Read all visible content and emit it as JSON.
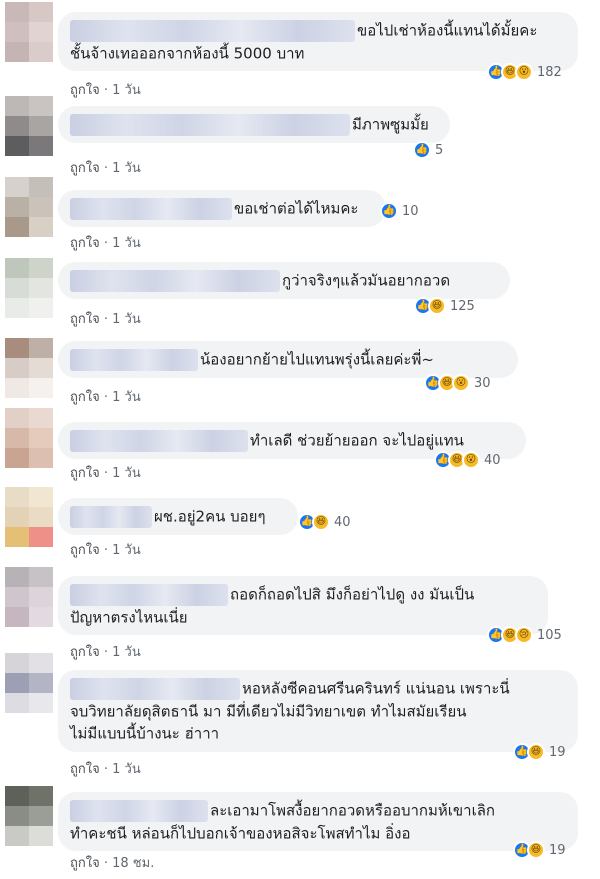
{
  "comments": [
    {
      "text_lines": [
        "ขอไปเช่าห้องนี้แทนได้มั้ยคะ",
        "ชั้นจ้างเทอออกจากห้องนี้ 5000 บาท"
      ],
      "like_label": "ถูกใจ",
      "time": "1 วัน",
      "reactions": [
        "like",
        "haha",
        "wow"
      ],
      "count": "182",
      "avatar_colors": [
        "#c8b9b8",
        "#d7c8c6",
        "#cfc0bf",
        "#e0d3d2",
        "#c4b4b4",
        "#dacccb"
      ]
    },
    {
      "text_lines": [
        "มีภาพซูมมั้ย"
      ],
      "like_label": "ถูกใจ",
      "time": "1 วัน",
      "reactions": [
        "like"
      ],
      "count": "5",
      "avatar_colors": [
        "#bdb8b6",
        "#c9c4c2",
        "#8f8b8a",
        "#a9a5a3",
        "#5d5c5e",
        "#7a787a"
      ]
    },
    {
      "text_lines": [
        "ขอเช่าต่อได้ไหมคะ"
      ],
      "like_label": "ถูกใจ",
      "time": "1 วัน",
      "reactions": [
        "like"
      ],
      "count": "10",
      "avatar_colors": [
        "#d6d1cd",
        "#c5bfb9",
        "#b9b0a6",
        "#cbc3b9",
        "#a8998b",
        "#d8cfc5"
      ]
    },
    {
      "text_lines": [
        "กูว่าจริงๆแล้วมันอยากอวด"
      ],
      "like_label": "ถูกใจ",
      "time": "1 วัน",
      "reactions": [
        "like",
        "haha"
      ],
      "count": "125",
      "avatar_colors": [
        "#bfc7bd",
        "#cfd4cb",
        "#d8dcd6",
        "#e3e5e1",
        "#e9ebe8",
        "#f0f1ef"
      ]
    },
    {
      "text_lines": [
        "น้องอยากย้ายไปแทนพรุ่งนี้เลยค่ะพี่~"
      ],
      "like_label": "ถูกใจ",
      "time": "1 วัน",
      "reactions": [
        "like",
        "haha",
        "wow"
      ],
      "count": "30",
      "avatar_colors": [
        "#a88d7e",
        "#bfb0a7",
        "#d8cdc6",
        "#e5dbd5",
        "#efe8e4",
        "#f5f1ee"
      ]
    },
    {
      "text_lines": [
        "ทำเลดี ช่วยย้ายออก จะไปอยู่แทน"
      ],
      "like_label": "ถูกใจ",
      "time": "1 วัน",
      "reactions": [
        "like",
        "haha",
        "wow"
      ],
      "count": "40",
      "avatar_colors": [
        "#e2cfc6",
        "#ead9d0",
        "#d6b9a9",
        "#e4cbbc",
        "#c9a492",
        "#dcbfb0"
      ]
    },
    {
      "text_lines": [
        "ผช.อยู่2คน บอยๆ"
      ],
      "like_label": "ถูกใจ",
      "time": "1 วัน",
      "reactions": [
        "like",
        "haha"
      ],
      "count": "40",
      "avatar_colors": [
        "#e8dcc6",
        "#f0e6d2",
        "#e4d2b6",
        "#eadcc4",
        "#e6bf76",
        "#ee8f88"
      ]
    },
    {
      "text_lines": [
        "ถอดก็ถอดไปสิ มึงก็อย่าไปดู งง มันเป็น",
        "ปัญหาตรงไหนเนี่ย"
      ],
      "like_label": "ถูกใจ",
      "time": "1 วัน",
      "reactions": [
        "like",
        "haha",
        "sad"
      ],
      "count": "105",
      "avatar_colors": [
        "#b7b2b6",
        "#c7c2c6",
        "#cfc6cd",
        "#dcd4da",
        "#c6b6c0",
        "#e2dae0"
      ]
    },
    {
      "text_lines": [
        "หอหลังซีคอนศรีนครินทร์ แน่นอน เพราะนี่",
        "จบวิทยาลัยดุสิตธานี มา มีที่เดียวไม่มีวิทยาเขต ทำไมสมัยเรียน",
        "ไม่มีแบบนี้บ้างนะ ฮ่าาา"
      ],
      "like_label": "ถูกใจ",
      "time": "1 วัน",
      "reactions": [
        "like",
        "haha"
      ],
      "count": "19",
      "avatar_colors": [
        "#d6d4d8",
        "#e2e0e4",
        "#9da0b4",
        "#b3b5c4",
        "#dcdce2",
        "#e8e8ec"
      ]
    },
    {
      "text_lines": [
        "ละเอามาโพสงื้อยากอวดหรืออบากมห้เขาเลิก",
        "ทำคะชนี หล่อนก็ไปบอกเจ้าของหอสิจะโพสทำไม อิ่งอ"
      ],
      "like_label": "ถูกใจ",
      "time": "18 ชม.",
      "reactions": [
        "like",
        "haha"
      ],
      "count": "19",
      "avatar_colors": [
        "#5e6159",
        "#6f7269",
        "#8a8c86",
        "#9b9d97",
        "#c9cac6",
        "#dcdcd9"
      ]
    }
  ],
  "reaction_glyphs": {
    "like": "👍",
    "haha": "😆",
    "wow": "😮",
    "sad": "😢"
  },
  "meta_separator": " · "
}
